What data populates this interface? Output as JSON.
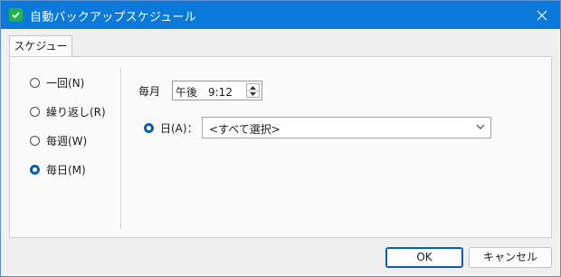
{
  "window": {
    "title": "自動バックアップスケジュール"
  },
  "tabs": [
    {
      "label": "スケジュール"
    }
  ],
  "frequency": {
    "options": [
      {
        "label": "一回(N)",
        "checked": false
      },
      {
        "label": "繰り返し(R)",
        "checked": false
      },
      {
        "label": "毎週(W)",
        "checked": false
      },
      {
        "label": "毎日(M)",
        "checked": true
      }
    ]
  },
  "schedule": {
    "monthly_label": "毎月",
    "time_value": "午後　9:12",
    "day_option_label": "日(A)：",
    "day_option_checked": true,
    "day_select_value": "<すべて選択>"
  },
  "buttons": {
    "ok": "OK",
    "cancel": "キャンセル"
  },
  "colors": {
    "titlebar": "#0b79d9",
    "accent": "#0b5cad",
    "app_icon": "#22b14c"
  },
  "icons": {
    "app": "shield-check-icon",
    "close": "close-icon",
    "dropdown": "chevron-down-icon",
    "spin_up": "triangle-up-icon",
    "spin_down": "triangle-down-icon"
  }
}
